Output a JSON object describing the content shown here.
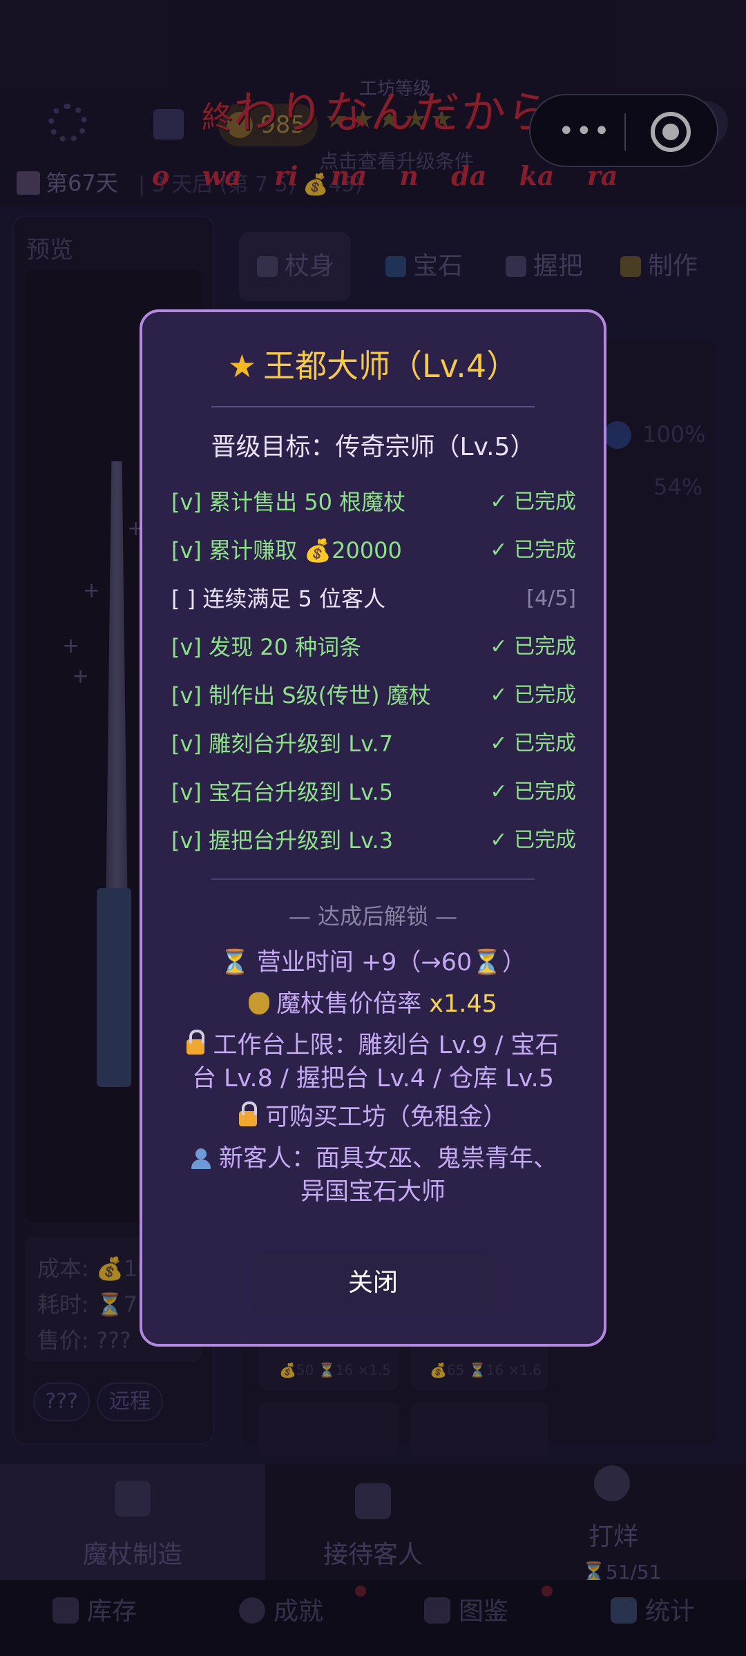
{
  "background": {
    "coins": "985",
    "workshop_level_label": "工坊等级",
    "level_stars": "★★★★★",
    "level_hint": "点击查看升级条件",
    "day": "第67天",
    "day_tail": "| 3 天后 (第 7 5) 💰45)",
    "preview_title": "预览",
    "stats": {
      "cost": "成本: 💰10",
      "time": "耗时: ⏳7",
      "price": "售价: ???"
    },
    "tags": [
      "???",
      "远程"
    ],
    "tabs": [
      "杖身",
      "宝石",
      "握把",
      "制作"
    ],
    "ghost_percents": [
      "100%",
      "54%"
    ],
    "cards": [
      {
        "stat": "💰50 ⏳16 ×1.5"
      },
      {
        "stat": "💰65 ⏳16 ×1.6"
      }
    ],
    "nav": {
      "items": [
        "魔杖制造",
        "接待客人",
        "打烊"
      ],
      "close_counter": "⏳51/51"
    },
    "subnav": [
      "库存",
      "成就",
      "图鉴",
      "统计"
    ]
  },
  "lyrics": {
    "jp_kanji": "終",
    "jp_kana": "わりなんだから",
    "romaji": "o wa ri na n da ka ra"
  },
  "modal": {
    "title": "王都大师（Lv.4）",
    "target": "晋级目标：传奇宗师（Lv.5）",
    "requirements": [
      {
        "text": "[v] 累计售出 50 根魔杖",
        "status": "✓ 已完成",
        "done": true
      },
      {
        "text": "[v] 累计赚取 💰20000",
        "status": "✓ 已完成",
        "done": true
      },
      {
        "text": "[ ] 连续满足 5 位客人",
        "status": "[4/5]",
        "done": false
      },
      {
        "text": "[v] 发现 20 种词条",
        "status": "✓ 已完成",
        "done": true
      },
      {
        "text": "[v] 制作出 S级(传世) 魔杖",
        "status": "✓ 已完成",
        "done": true
      },
      {
        "text": "[v] 雕刻台升级到 Lv.7",
        "status": "✓ 已完成",
        "done": true
      },
      {
        "text": "[v] 宝石台升级到 Lv.5",
        "status": "✓ 已完成",
        "done": true
      },
      {
        "text": "[v] 握把台升级到 Lv.3",
        "status": "✓ 已完成",
        "done": true
      }
    ],
    "unlock_header": "— 达成后解锁 —",
    "unlocks": {
      "hours_text": "营业时间 +9（→60⏳）",
      "price_text": "魔杖售价倍率 ",
      "price_value": "x1.45",
      "bench_line1": "工作台上限：雕刻台 Lv.9 / 宝石",
      "bench_line2": "台 Lv.8 / 握把台 Lv.4 / 仓库 Lv.5",
      "buy_text": "可购买工坊（免租金）",
      "customers_line1": "新客人：面具女巫、鬼祟青年、",
      "customers_line2": "异国宝石大师"
    },
    "close_label": "关闭"
  },
  "colors": {
    "modal_bg": "#2c2148",
    "modal_border": "#b38ae0",
    "title_gold": "#f5c94a",
    "done_green": "#8ee08a",
    "unlock_purple": "#c4aaf2"
  }
}
